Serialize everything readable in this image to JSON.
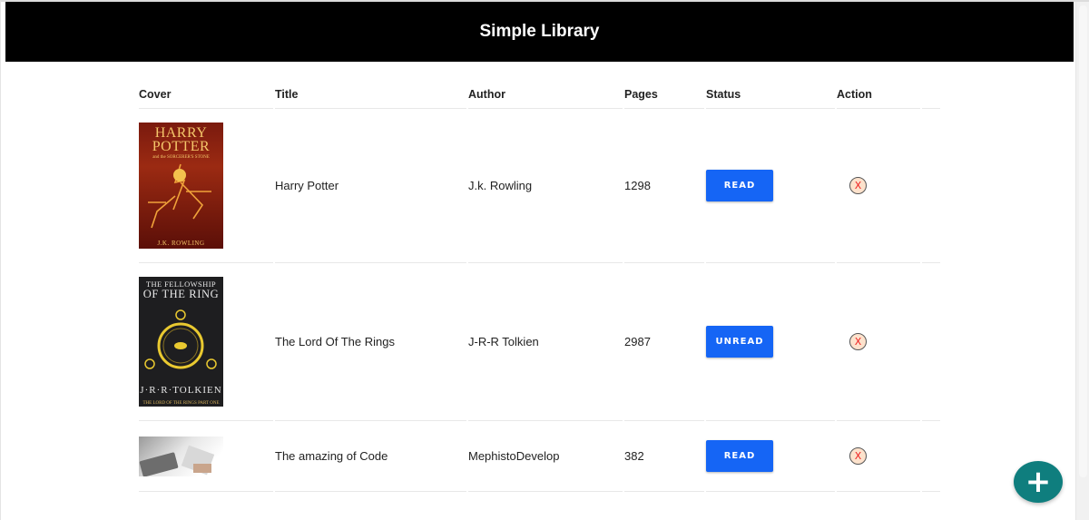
{
  "header": {
    "title": "Simple Library"
  },
  "table": {
    "columns": [
      "Cover",
      "Title",
      "Author",
      "Pages",
      "Status",
      "Action"
    ],
    "rows": [
      {
        "title": "Harry Potter",
        "author": "J.k. Rowling",
        "pages": "1298",
        "status": "READ",
        "cover": {
          "line1": "HARRY POTTER",
          "line2": "and the SORCERER'S STONE",
          "author": "J.K. ROWLING"
        }
      },
      {
        "title": "The Lord Of The Rings",
        "author": "J-R-R Tolkien",
        "pages": "2987",
        "status": "UNREAD",
        "cover": {
          "line1": "THE FELLOWSHIP",
          "line2": "OF THE RING",
          "author": "J·R·R·TOLKIEN",
          "sub": "THE LORD OF THE RINGS PART ONE"
        }
      },
      {
        "title": "The amazing of Code",
        "author": "MephistoDevelop",
        "pages": "382",
        "status": "READ",
        "cover": {}
      }
    ],
    "delete_glyph": "X"
  },
  "fab": {
    "icon": "plus-icon",
    "glyph": "+"
  },
  "colors": {
    "header_bg": "#000000",
    "status_button": "#1565f5",
    "fab": "#0f7e7e",
    "delete_bg": "#fde2cc"
  }
}
